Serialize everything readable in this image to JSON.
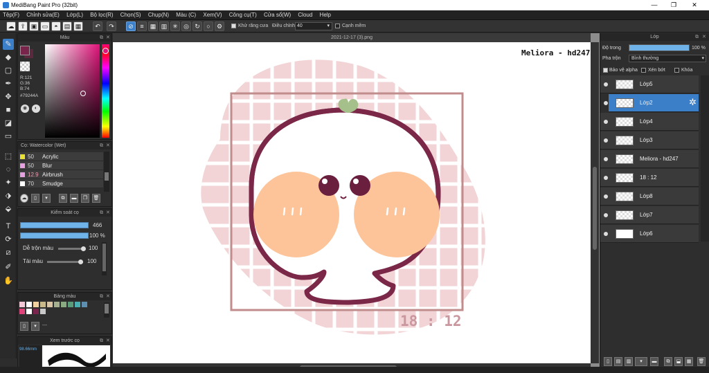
{
  "app": {
    "title": "MediBang Paint Pro (32bit)",
    "min": "—",
    "max": "❐",
    "close": "✕"
  },
  "menu": [
    "Tệp(F)",
    "Chỉnh sửa(E)",
    "Lớp(L)",
    "Bộ lọc(R)",
    "Chọn(S)",
    "Chụp(N)",
    "Màu (C)",
    "Xem(V)",
    "Công cụ(T)",
    "Cửa sổ(W)",
    "Cloud",
    "Help"
  ],
  "toolbar": {
    "antialias_label": "Khử răng cưa",
    "adjust_label": "Điều chỉnh",
    "adjust_value": "40",
    "smooth_label": "Cạnh mềm"
  },
  "color_panel": {
    "title": "Màu",
    "r": "R:121",
    "g": "G:36",
    "b": "B:74",
    "hex": "#79244A",
    "fg_color": "#79244a"
  },
  "brush_panel": {
    "title": "Cọ: Watercolor (Wet)",
    "items": [
      {
        "size": "50",
        "name": "Acrylic",
        "color": "#e8e034"
      },
      {
        "size": "50",
        "name": "Blur",
        "color": "#e6a0e0"
      },
      {
        "size": "12.9",
        "name": "Airbrush",
        "color": "#e6a0e0"
      },
      {
        "size": "70",
        "name": "Smudge",
        "color": "#ffffff"
      }
    ]
  },
  "brush_control": {
    "title": "Kiểm soát cọ",
    "size_value": "466",
    "opacity_value": "100 %",
    "blend_label": "Dễ trộn màu",
    "blend_value": "100",
    "reload_label": "Tải màu",
    "reload_value": "100"
  },
  "palette": {
    "title": "Bảng màu",
    "extra": "---",
    "colors": [
      "#f3c9d8",
      "#ffffff",
      "#f3d0a0",
      "#c9b98a",
      "#d9c4a6",
      "#a4b090",
      "#8aaa82",
      "#5a9c7a",
      "#48b0b0",
      "#5f8fb0",
      "#e0437a",
      "#ffffff",
      "#79244a",
      "#c8c8c8"
    ]
  },
  "preview": {
    "title": "Xem trước cọ",
    "size": "98.66mm"
  },
  "canvas": {
    "doc_title": "2021-12-17 (3).png",
    "signature": "Meliora - hd247",
    "time_text": "18 : 12"
  },
  "layers": {
    "title": "Lớp",
    "opacity_label": "Độ trong",
    "opacity_value": "100 %",
    "opacity": 1.0,
    "blend_label": "Pha trộn",
    "blend_value": "Bình thường",
    "protect_alpha": "Bảo vệ alpha",
    "clipping": "Xén bớt",
    "lock": "Khóa",
    "items": [
      {
        "name": "Lớp5",
        "active": false
      },
      {
        "name": "Lớp2",
        "active": true
      },
      {
        "name": "Lớp4",
        "active": false
      },
      {
        "name": "Lớp3",
        "active": false
      },
      {
        "name": "Meliora - hd247",
        "active": false
      },
      {
        "name": "18 : 12",
        "active": false
      },
      {
        "name": "Lớp8",
        "active": false
      },
      {
        "name": "Lớp7",
        "active": false
      },
      {
        "name": "Lớp6",
        "active": false
      }
    ]
  }
}
